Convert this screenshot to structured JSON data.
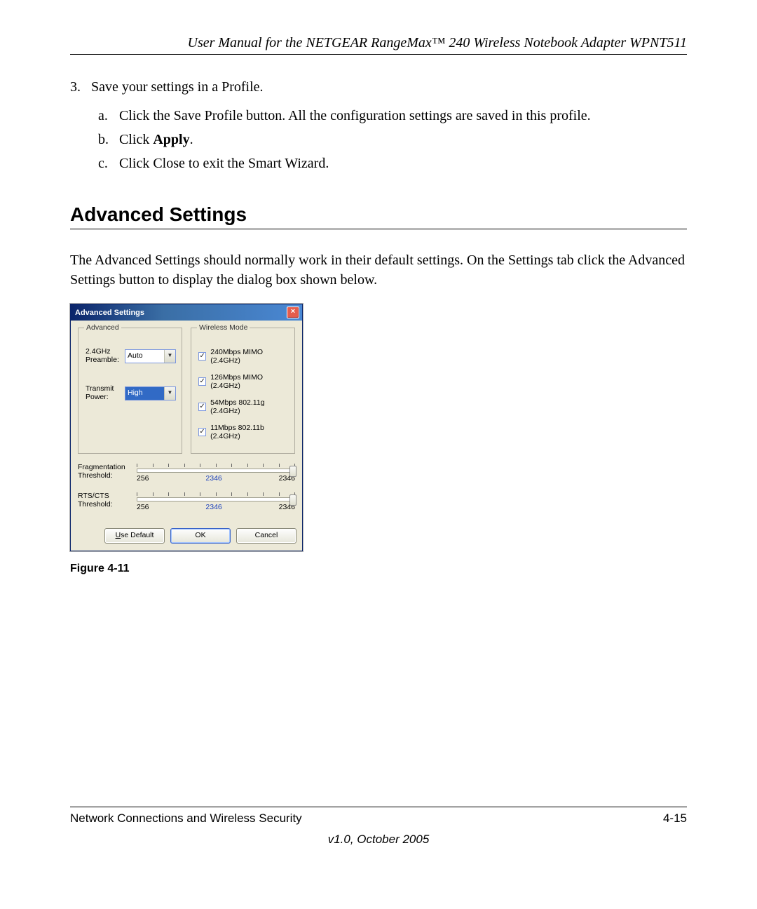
{
  "header": {
    "running_title": "User Manual for the NETGEAR RangeMax™ 240 Wireless Notebook Adapter WPNT511"
  },
  "step": {
    "number": "3.",
    "text": "Save your settings in a Profile.",
    "subs": {
      "a": {
        "letter": "a.",
        "text": "Click the Save Profile button. All the configuration settings are saved in this profile."
      },
      "b": {
        "letter": "b.",
        "prefix": "Click ",
        "bold": "Apply",
        "suffix": "."
      },
      "c": {
        "letter": "c.",
        "text": "Click Close to exit the Smart Wizard."
      }
    }
  },
  "section": {
    "heading": "Advanced Settings",
    "paragraph": "The Advanced Settings should normally work in their default settings. On the Settings tab click the Advanced Settings button to display the dialog box shown below."
  },
  "dialog": {
    "title": "Advanced Settings",
    "advanced": {
      "legend": "Advanced",
      "preamble_label": "2.4GHz Preamble:",
      "preamble_value": "Auto",
      "power_label": "Transmit Power:",
      "power_value": "High"
    },
    "wireless": {
      "legend": "Wireless Mode",
      "modes": [
        "240Mbps MIMO (2.4GHz)",
        "126Mbps MIMO (2.4GHz)",
        "54Mbps 802.11g (2.4GHz)",
        "11Mbps 802.11b (2.4GHz)"
      ]
    },
    "sliders": {
      "frag": {
        "label": "Fragmentation Threshold:",
        "min": "256",
        "value": "2346",
        "max": "2346"
      },
      "rts": {
        "label": "RTS/CTS Threshold:",
        "min": "256",
        "value": "2346",
        "max": "2346"
      }
    },
    "buttons": {
      "use_default": "Use Default",
      "ok": "OK",
      "cancel": "Cancel"
    }
  },
  "figure": {
    "caption": "Figure 4-11"
  },
  "footer": {
    "section": "Network Connections and Wireless Security",
    "page": "4-15",
    "version": "v1.0, October 2005"
  }
}
